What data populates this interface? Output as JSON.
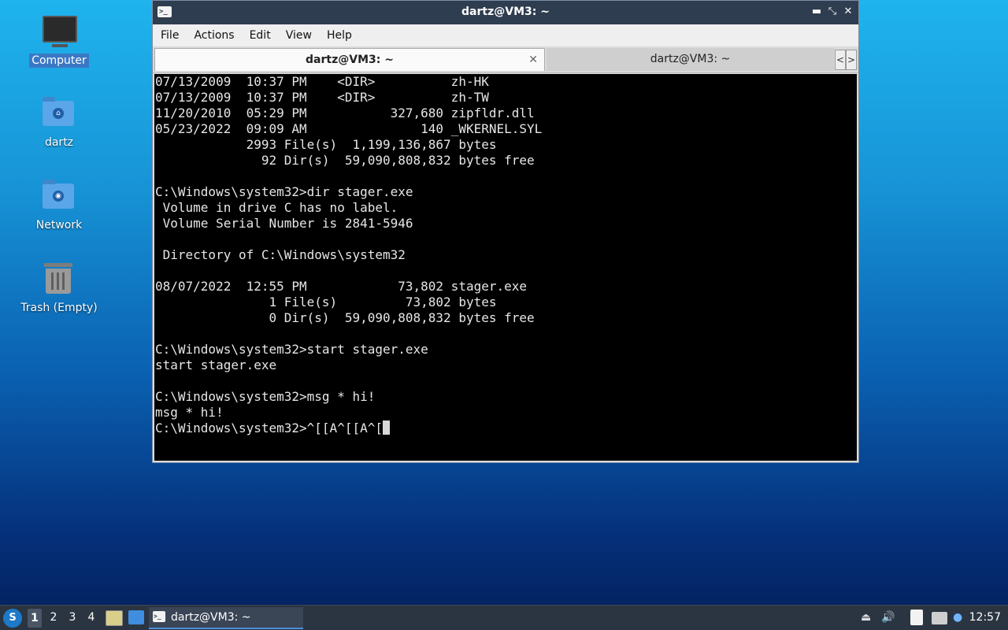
{
  "desktop": {
    "icons": [
      {
        "label": "Computer",
        "icon": "computer-icon"
      },
      {
        "label": "dartz",
        "icon": "home-folder-icon"
      },
      {
        "label": "Network",
        "icon": "network-folder-icon"
      },
      {
        "label": "Trash (Empty)",
        "icon": "trash-icon"
      }
    ]
  },
  "window": {
    "title": "dartz@VM3: ~",
    "icon": "terminal-icon",
    "controls": {
      "minimize": "▬",
      "maximize": "⤡",
      "close": "✕"
    },
    "menu": [
      "File",
      "Actions",
      "Edit",
      "View",
      "Help"
    ],
    "tabs": [
      {
        "label": "dartz@VM3: ~",
        "active": true,
        "close": "✕"
      },
      {
        "label": "dartz@VM3: ~",
        "active": false
      }
    ],
    "tab_scroll": {
      "left": "<",
      "right": ">"
    },
    "terminal": {
      "lines": [
        "07/13/2009  10:37 PM    <DIR>          zh-HK",
        "07/13/2009  10:37 PM    <DIR>          zh-TW",
        "11/20/2010  05:29 PM           327,680 zipfldr.dll",
        "05/23/2022  09:09 AM               140 _WKERNEL.SYL",
        "            2993 File(s)  1,199,136,867 bytes",
        "              92 Dir(s)  59,090,808,832 bytes free",
        "",
        "C:\\Windows\\system32>dir stager.exe",
        " Volume in drive C has no label.",
        " Volume Serial Number is 2841-5946",
        "",
        " Directory of C:\\Windows\\system32",
        "",
        "08/07/2022  12:55 PM            73,802 stager.exe",
        "               1 File(s)         73,802 bytes",
        "               0 Dir(s)  59,090,808,832 bytes free",
        "",
        "C:\\Windows\\system32>start stager.exe",
        "start stager.exe",
        "",
        "C:\\Windows\\system32>msg * hi!",
        "msg * hi!",
        ""
      ],
      "prompt_line": "C:\\Windows\\system32>^[[A^[[A^["
    }
  },
  "taskbar": {
    "start_icon": "start-menu-icon",
    "workspaces": [
      "1",
      "2",
      "3",
      "4"
    ],
    "current_workspace": "1",
    "task_label": "dartz@VM3: ~",
    "tray_icons": [
      "eject-icon",
      "volume-icon",
      "clipboard-icon",
      "network-icon",
      "update-notifier-icon"
    ],
    "clock": "12:57"
  },
  "colors": {
    "titlebar": "#2e3d4f",
    "terminal_bg": "#000000",
    "terminal_fg": "#e6e6e6",
    "taskbar": "#2b3441",
    "selection": "#3b78c4"
  }
}
